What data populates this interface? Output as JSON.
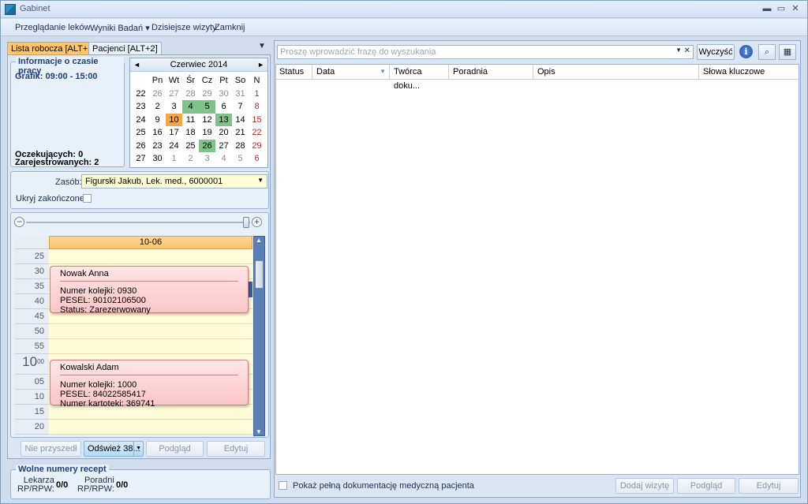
{
  "window": {
    "title": "Gabinet",
    "min": "▬",
    "max": "▭",
    "close": "✕"
  },
  "menu": [
    "Przeglądanie leków",
    "Wyniki Badań ▾",
    "Dzisiejsze wizyty",
    "Zamknij"
  ],
  "tabs": {
    "t1": "Lista robocza [ALT+1]",
    "t2": "Pacjenci [ALT+2]"
  },
  "work": {
    "title": "Informacje o czasie pracy",
    "schedule": "Grafik: 09:00 - 15:00",
    "waiting": "Oczekujących: 0",
    "registered": "Zarejestrowanych: 2"
  },
  "calendar": {
    "month": "Czerwiec 2014",
    "days": [
      "Pn",
      "Wt",
      "Śr",
      "Cz",
      "Pt",
      "So",
      "N"
    ],
    "weeks": [
      {
        "w": "22",
        "d": [
          "26",
          "27",
          "28",
          "29",
          "30",
          "31",
          "1"
        ]
      },
      {
        "w": "23",
        "d": [
          "2",
          "3",
          "4",
          "5",
          "6",
          "7",
          "8"
        ]
      },
      {
        "w": "24",
        "d": [
          "9",
          "10",
          "11",
          "12",
          "13",
          "14",
          "15"
        ]
      },
      {
        "w": "25",
        "d": [
          "16",
          "17",
          "18",
          "19",
          "20",
          "21",
          "22"
        ]
      },
      {
        "w": "26",
        "d": [
          "23",
          "24",
          "25",
          "26",
          "27",
          "28",
          "29"
        ]
      },
      {
        "w": "27",
        "d": [
          "30",
          "1",
          "2",
          "3",
          "4",
          "5",
          "6"
        ]
      }
    ]
  },
  "resource": {
    "label": "Zasób:",
    "value": "Figurski Jakub, Lek. med., 6000001",
    "hide_label": "Ukryj zakończone:"
  },
  "day": {
    "header": "10-06",
    "hour": "10",
    "hour_sup": "00",
    "times": [
      "25",
      "30",
      "35",
      "40",
      "45",
      "50",
      "55",
      "",
      "05",
      "10",
      "15",
      "20"
    ]
  },
  "appts": [
    {
      "name": "Nowak Anna",
      "l1": "Numer kolejki: 0930",
      "l2": "PESEL: 90102106500",
      "l3": "Status: Zarezerwowany"
    },
    {
      "name": "Kowalski Adam",
      "l1": "Numer kolejki: 1000",
      "l2": "PESEL: 84022585417",
      "l3": "Numer kartoteki: 369741"
    }
  ],
  "bottom_btns": {
    "notcame": "Nie przyszedł",
    "refresh": "Odśwież 38...",
    "preview": "Podgląd",
    "edit": "Edytuj"
  },
  "recipes": {
    "title": "Wolne numery recept",
    "doc_l1": "Lekarza",
    "doc_l2": "RP/RPW:",
    "doc_v": "0/0",
    "clinic_l1": "Poradni",
    "clinic_l2": "RP/RPW:",
    "clinic_v": "0/0"
  },
  "search": {
    "placeholder": "Proszę wprowadzić frazę do wyszukania",
    "clear": "Wyczyść"
  },
  "columns": [
    "Status",
    "Data",
    "Twórca doku...",
    "Poradnia",
    "Opis",
    "Słowa kluczowe"
  ],
  "footer": {
    "full_doc": "Pokaż pełną dokumentację medyczną pacjenta",
    "add_visit": "Dodaj wizytę",
    "preview": "Podgląd",
    "edit": "Edytuj"
  }
}
